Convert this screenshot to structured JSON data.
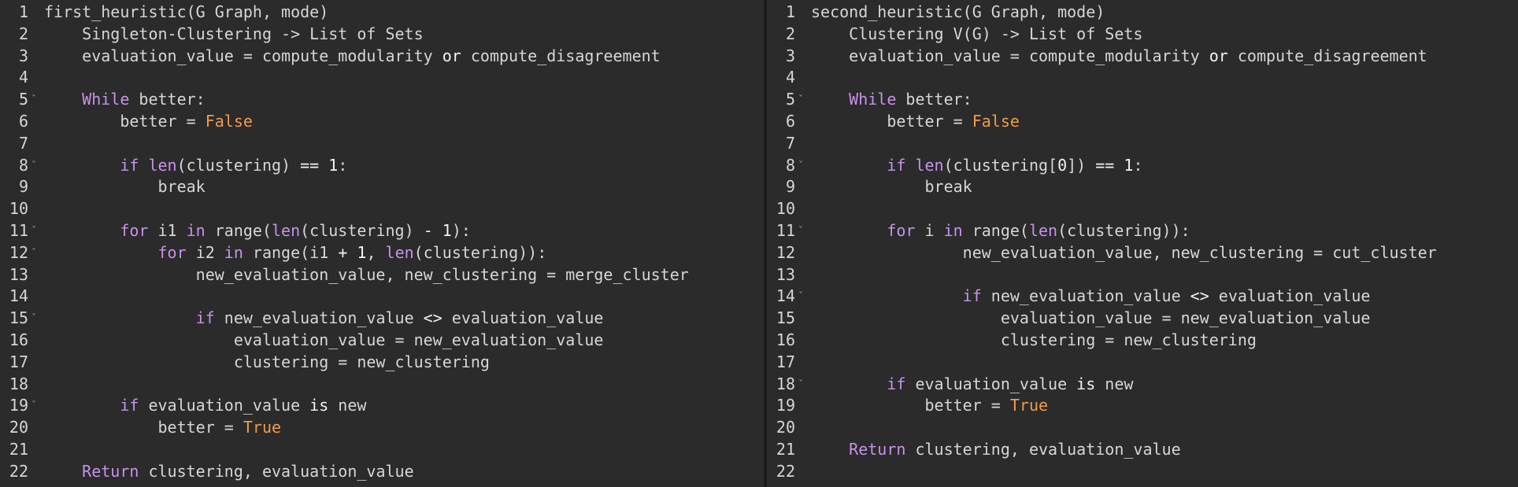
{
  "panes": [
    {
      "id": "left",
      "lines": [
        {
          "n": "1",
          "fold": false,
          "tokens": [
            {
              "t": "first_heuristic(G Graph, mode)",
              "k": "plain"
            }
          ]
        },
        {
          "n": "2",
          "fold": false,
          "tokens": [
            {
              "t": "    Singleton-Clustering -> List of Sets",
              "k": "plain"
            }
          ]
        },
        {
          "n": "3",
          "fold": false,
          "tokens": [
            {
              "t": "    evaluation_value = compute_modularity ",
              "k": "plain"
            },
            {
              "t": "or",
              "k": "bold"
            },
            {
              "t": " compute_disagreement",
              "k": "plain"
            }
          ]
        },
        {
          "n": "4",
          "fold": false,
          "tokens": []
        },
        {
          "n": "5",
          "fold": true,
          "tokens": [
            {
              "t": "    ",
              "k": "plain"
            },
            {
              "t": "While",
              "k": "kw"
            },
            {
              "t": " better:",
              "k": "plain"
            }
          ]
        },
        {
          "n": "6",
          "fold": false,
          "tokens": [
            {
              "t": "        better = ",
              "k": "plain"
            },
            {
              "t": "False",
              "k": "const"
            }
          ]
        },
        {
          "n": "7",
          "fold": false,
          "tokens": []
        },
        {
          "n": "8",
          "fold": true,
          "tokens": [
            {
              "t": "        ",
              "k": "plain"
            },
            {
              "t": "if",
              "k": "kw"
            },
            {
              "t": " ",
              "k": "plain"
            },
            {
              "t": "len",
              "k": "fn"
            },
            {
              "t": "(clustering) ",
              "k": "plain"
            },
            {
              "t": "==",
              "k": "op"
            },
            {
              "t": " ",
              "k": "plain"
            },
            {
              "t": "1",
              "k": "num"
            },
            {
              "t": ":",
              "k": "plain"
            }
          ]
        },
        {
          "n": "9",
          "fold": false,
          "tokens": [
            {
              "t": "            break",
              "k": "plain"
            }
          ]
        },
        {
          "n": "10",
          "fold": false,
          "tokens": []
        },
        {
          "n": "11",
          "fold": true,
          "tokens": [
            {
              "t": "        ",
              "k": "plain"
            },
            {
              "t": "for",
              "k": "kw"
            },
            {
              "t": " i1 ",
              "k": "plain"
            },
            {
              "t": "in",
              "k": "kw"
            },
            {
              "t": " range(",
              "k": "plain"
            },
            {
              "t": "len",
              "k": "fn"
            },
            {
              "t": "(clustering) ",
              "k": "plain"
            },
            {
              "t": "-",
              "k": "op"
            },
            {
              "t": " ",
              "k": "plain"
            },
            {
              "t": "1",
              "k": "num"
            },
            {
              "t": "):",
              "k": "plain"
            }
          ]
        },
        {
          "n": "12",
          "fold": true,
          "tokens": [
            {
              "t": "            ",
              "k": "plain"
            },
            {
              "t": "for",
              "k": "kw"
            },
            {
              "t": " i2 ",
              "k": "plain"
            },
            {
              "t": "in",
              "k": "kw"
            },
            {
              "t": " range(i1 ",
              "k": "plain"
            },
            {
              "t": "+",
              "k": "op"
            },
            {
              "t": " ",
              "k": "plain"
            },
            {
              "t": "1",
              "k": "num"
            },
            {
              "t": ", ",
              "k": "plain"
            },
            {
              "t": "len",
              "k": "fn"
            },
            {
              "t": "(clustering)):",
              "k": "plain"
            }
          ]
        },
        {
          "n": "13",
          "fold": false,
          "tokens": [
            {
              "t": "                new_evaluation_value, new_clustering = merge_cluster",
              "k": "plain"
            }
          ]
        },
        {
          "n": "14",
          "fold": false,
          "tokens": []
        },
        {
          "n": "15",
          "fold": true,
          "tokens": [
            {
              "t": "                ",
              "k": "plain"
            },
            {
              "t": "if",
              "k": "kw"
            },
            {
              "t": " new_evaluation_value ",
              "k": "plain"
            },
            {
              "t": "<>",
              "k": "op"
            },
            {
              "t": " evaluation_value",
              "k": "plain"
            }
          ]
        },
        {
          "n": "16",
          "fold": false,
          "tokens": [
            {
              "t": "                    evaluation_value = new_evaluation_value",
              "k": "plain"
            }
          ]
        },
        {
          "n": "17",
          "fold": false,
          "tokens": [
            {
              "t": "                    clustering = new_clustering",
              "k": "plain"
            }
          ]
        },
        {
          "n": "18",
          "fold": false,
          "tokens": []
        },
        {
          "n": "19",
          "fold": true,
          "tokens": [
            {
              "t": "        ",
              "k": "plain"
            },
            {
              "t": "if",
              "k": "kw"
            },
            {
              "t": " evaluation_value ",
              "k": "plain"
            },
            {
              "t": "is",
              "k": "bold"
            },
            {
              "t": " new",
              "k": "plain"
            }
          ]
        },
        {
          "n": "20",
          "fold": false,
          "tokens": [
            {
              "t": "            better = ",
              "k": "plain"
            },
            {
              "t": "True",
              "k": "const"
            }
          ]
        },
        {
          "n": "21",
          "fold": false,
          "tokens": []
        },
        {
          "n": "22",
          "fold": false,
          "tokens": [
            {
              "t": "    ",
              "k": "plain"
            },
            {
              "t": "Return",
              "k": "kw"
            },
            {
              "t": " clustering, evaluation_value",
              "k": "plain"
            }
          ]
        }
      ]
    },
    {
      "id": "right",
      "lines": [
        {
          "n": "1",
          "fold": false,
          "tokens": [
            {
              "t": "second_heuristic(G Graph, mode)",
              "k": "plain"
            }
          ]
        },
        {
          "n": "2",
          "fold": false,
          "tokens": [
            {
              "t": "    Clustering V(G) -> List of Sets",
              "k": "plain"
            }
          ]
        },
        {
          "n": "3",
          "fold": false,
          "tokens": [
            {
              "t": "    evaluation_value = compute_modularity ",
              "k": "plain"
            },
            {
              "t": "or",
              "k": "bold"
            },
            {
              "t": " compute_disagreement",
              "k": "plain"
            }
          ]
        },
        {
          "n": "4",
          "fold": false,
          "tokens": []
        },
        {
          "n": "5",
          "fold": true,
          "tokens": [
            {
              "t": "    ",
              "k": "plain"
            },
            {
              "t": "While",
              "k": "kw"
            },
            {
              "t": " better:",
              "k": "plain"
            }
          ]
        },
        {
          "n": "6",
          "fold": false,
          "tokens": [
            {
              "t": "        better = ",
              "k": "plain"
            },
            {
              "t": "False",
              "k": "const"
            }
          ]
        },
        {
          "n": "7",
          "fold": false,
          "tokens": []
        },
        {
          "n": "8",
          "fold": true,
          "tokens": [
            {
              "t": "        ",
              "k": "plain"
            },
            {
              "t": "if",
              "k": "kw"
            },
            {
              "t": " ",
              "k": "plain"
            },
            {
              "t": "len",
              "k": "fn"
            },
            {
              "t": "(clustering[",
              "k": "plain"
            },
            {
              "t": "0",
              "k": "num"
            },
            {
              "t": "]) ",
              "k": "plain"
            },
            {
              "t": "==",
              "k": "op"
            },
            {
              "t": " ",
              "k": "plain"
            },
            {
              "t": "1",
              "k": "num"
            },
            {
              "t": ":",
              "k": "plain"
            }
          ]
        },
        {
          "n": "9",
          "fold": false,
          "tokens": [
            {
              "t": "            break",
              "k": "plain"
            }
          ]
        },
        {
          "n": "10",
          "fold": false,
          "tokens": []
        },
        {
          "n": "11",
          "fold": true,
          "tokens": [
            {
              "t": "        ",
              "k": "plain"
            },
            {
              "t": "for",
              "k": "kw"
            },
            {
              "t": " i ",
              "k": "plain"
            },
            {
              "t": "in",
              "k": "kw"
            },
            {
              "t": " range(",
              "k": "plain"
            },
            {
              "t": "len",
              "k": "fn"
            },
            {
              "t": "(clustering)):",
              "k": "plain"
            }
          ]
        },
        {
          "n": "12",
          "fold": false,
          "tokens": [
            {
              "t": "                new_evaluation_value, new_clustering = cut_cluster",
              "k": "plain"
            }
          ]
        },
        {
          "n": "13",
          "fold": false,
          "tokens": []
        },
        {
          "n": "14",
          "fold": true,
          "tokens": [
            {
              "t": "                ",
              "k": "plain"
            },
            {
              "t": "if",
              "k": "kw"
            },
            {
              "t": " new_evaluation_value ",
              "k": "plain"
            },
            {
              "t": "<>",
              "k": "op"
            },
            {
              "t": " evaluation_value",
              "k": "plain"
            }
          ]
        },
        {
          "n": "15",
          "fold": false,
          "tokens": [
            {
              "t": "                    evaluation_value = new_evaluation_value",
              "k": "plain"
            }
          ]
        },
        {
          "n": "16",
          "fold": false,
          "tokens": [
            {
              "t": "                    clustering = new_clustering",
              "k": "plain"
            }
          ]
        },
        {
          "n": "17",
          "fold": false,
          "tokens": []
        },
        {
          "n": "18",
          "fold": true,
          "tokens": [
            {
              "t": "        ",
              "k": "plain"
            },
            {
              "t": "if",
              "k": "kw"
            },
            {
              "t": " evaluation_value ",
              "k": "plain"
            },
            {
              "t": "is",
              "k": "bold"
            },
            {
              "t": " new",
              "k": "plain"
            }
          ]
        },
        {
          "n": "19",
          "fold": false,
          "tokens": [
            {
              "t": "            better = ",
              "k": "plain"
            },
            {
              "t": "True",
              "k": "const"
            }
          ]
        },
        {
          "n": "20",
          "fold": false,
          "tokens": []
        },
        {
          "n": "21",
          "fold": false,
          "tokens": [
            {
              "t": "    ",
              "k": "plain"
            },
            {
              "t": "Return",
              "k": "kw"
            },
            {
              "t": " clustering, evaluation_value",
              "k": "plain"
            }
          ]
        },
        {
          "n": "22",
          "fold": false,
          "tokens": []
        }
      ]
    }
  ],
  "colors": {
    "background": "#2b2b2b",
    "text": "#d6d6d6",
    "keyword": "#c792ea",
    "constant": "#f29a4a",
    "operator": "#f2f2f2"
  },
  "icons": {
    "fold": "chevron-down-icon"
  }
}
